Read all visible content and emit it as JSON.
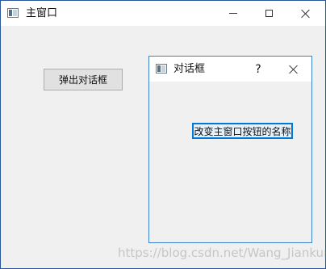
{
  "main_window": {
    "title": "主窗口",
    "open_dialog_button_label": "弹出对话框"
  },
  "dialog": {
    "title": "对话框",
    "help_label": "?",
    "change_name_button_label": "改变主窗口按钮的名称"
  },
  "watermark": "https://blog.csdn.net/Wang_Jiankun",
  "icons": {
    "app": "window-icon",
    "minimize": "minimize-icon",
    "maximize": "maximize-icon",
    "close": "close-icon"
  },
  "colors": {
    "main_border": "#2b579a",
    "dialog_border": "#3c82c6",
    "focus_border": "#0078d7",
    "window_bg": "#f0f0f0"
  }
}
